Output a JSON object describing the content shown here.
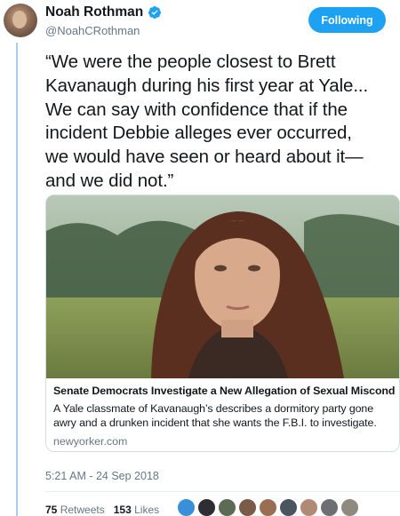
{
  "author": {
    "display_name": "Noah Rothman",
    "handle": "@NoahCRothman",
    "verified": true
  },
  "follow_button": {
    "label": "Following"
  },
  "tweet": {
    "text": "“We were the people closest to Brett\nKavanaugh during his first year at Yale...\nWe can say with confidence that if the\nincident Debbie alleges ever occurred,\nwe would have seen or heard about it—\nand we did not.”"
  },
  "card": {
    "title": "Senate Democrats Investigate a New Allegation of Sexual Miscondu...",
    "description": "A Yale classmate of Kavanaugh’s describes a dormitory party gone awry and a drunken incident that she wants the F.B.I. to investigate.",
    "domain": "newyorker.com"
  },
  "timestamp": "5:21 AM - 24 Sep 2018",
  "stats": {
    "retweets_count": "75",
    "retweets_label": "Retweets",
    "likes_count": "153",
    "likes_label": "Likes"
  },
  "colors": {
    "accent": "#1da1f2",
    "secondary_text": "#657786",
    "thread_line": "#a9cfe8"
  },
  "icons": [
    "verified-badge-icon"
  ]
}
